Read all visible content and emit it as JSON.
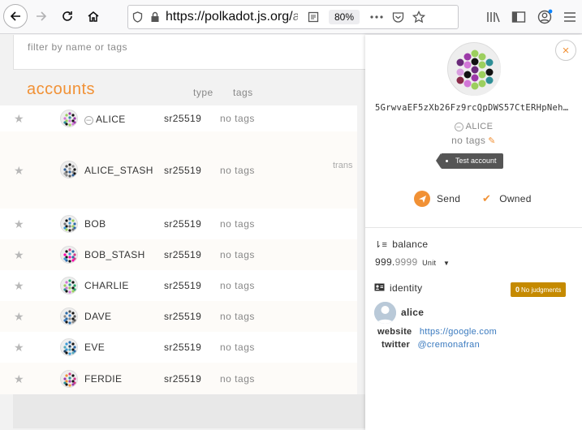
{
  "browser": {
    "url_host": "https://polkadot.js.org/",
    "url_rest": "apps",
    "zoom": "80%"
  },
  "filter": {
    "placeholder": "filter by name or tags"
  },
  "table": {
    "title": "accounts",
    "col_type": "type",
    "col_tags": "tags",
    "rows": [
      {
        "name": "ALICE",
        "type": "sr25519",
        "tags": "no tags"
      },
      {
        "name": "ALICE_STASH",
        "type": "sr25519",
        "tags": "no tags",
        "extra": "trans"
      },
      {
        "name": "BOB",
        "type": "sr25519",
        "tags": "no tags"
      },
      {
        "name": "BOB_STASH",
        "type": "sr25519",
        "tags": "no tags"
      },
      {
        "name": "CHARLIE",
        "type": "sr25519",
        "tags": "no tags"
      },
      {
        "name": "DAVE",
        "type": "sr25519",
        "tags": "no tags"
      },
      {
        "name": "EVE",
        "type": "sr25519",
        "tags": "no tags"
      },
      {
        "name": "FERDIE",
        "type": "sr25519",
        "tags": "no tags"
      }
    ]
  },
  "panel": {
    "close": "×",
    "address": "5GrwvaEF5zXb26Fz9rcQpDWS57CtERHpNeh…",
    "name": "ALICE",
    "tags": "no tags",
    "badge": "Test account",
    "send": "Send",
    "owned": "Owned",
    "balance_label": "balance",
    "balance_int": "999.",
    "balance_dec": "9999",
    "balance_unit": "Unit",
    "identity_label": "identity",
    "judgment_count": "0",
    "judgment_text": "No judgments",
    "display": "alice",
    "website_label": "website",
    "website_value": "https://google.com",
    "twitter_label": "twitter",
    "twitter_value": "@cremonafran"
  },
  "colors": {
    "accent": "#f19135",
    "link": "#3a7abf",
    "judgment": "#c58a00"
  }
}
